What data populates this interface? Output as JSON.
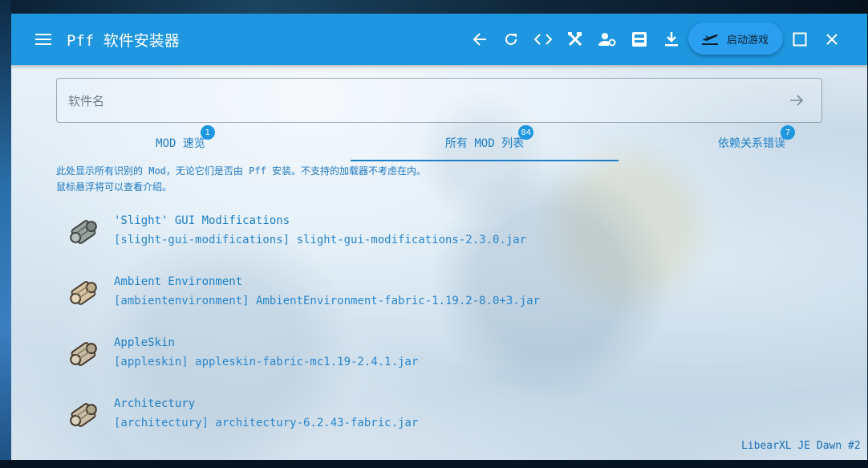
{
  "app": {
    "title": "Pff 软件安装器"
  },
  "toolbar": {
    "icons": [
      "menu-icon",
      "arrow-back-icon",
      "refresh-icon",
      "code-icon",
      "tools-icon",
      "manage-accounts-icon",
      "inbox-icon",
      "download-icon",
      "flight-takeoff-icon",
      "maximize-icon",
      "close-icon"
    ],
    "launch_label": "启动游戏",
    "accent": "#1e96e0"
  },
  "search": {
    "placeholder": "软件名"
  },
  "tabs": [
    {
      "label": "MOD 速览",
      "badge": "1"
    },
    {
      "label": "所有 MOD 列表",
      "badge": "84"
    },
    {
      "label": "依赖关系错误",
      "badge": "7"
    }
  ],
  "active_tab": "所有 MOD 列表",
  "info": {
    "line1": "此处显示所有识别的 Mod，无论它们是否由 Pff 安装。不支持的加载器不考虑在内。",
    "line2": "鼠标悬浮将可以查看介绍。"
  },
  "mods": [
    {
      "name": "'Slight' GUI Modifications",
      "file": "[slight-gui-modifications] slight-gui-modifications-2.3.0.jar",
      "icon": "scroll-icon"
    },
    {
      "name": "Ambient Environment",
      "file": "[ambientenvironment] AmbientEnvironment-fabric-1.19.2-8.0+3.jar",
      "icon": "scroll-icon"
    },
    {
      "name": "AppleSkin",
      "file": "[appleskin] appleskin-fabric-mc1.19-2.4.1.jar",
      "icon": "scroll-icon"
    },
    {
      "name": "Architectury",
      "file": "[architectury] architectury-6.2.43-fabric.jar",
      "icon": "scroll-icon"
    }
  ],
  "footer": {
    "brand": "LibearXL JE Dawn #2"
  }
}
